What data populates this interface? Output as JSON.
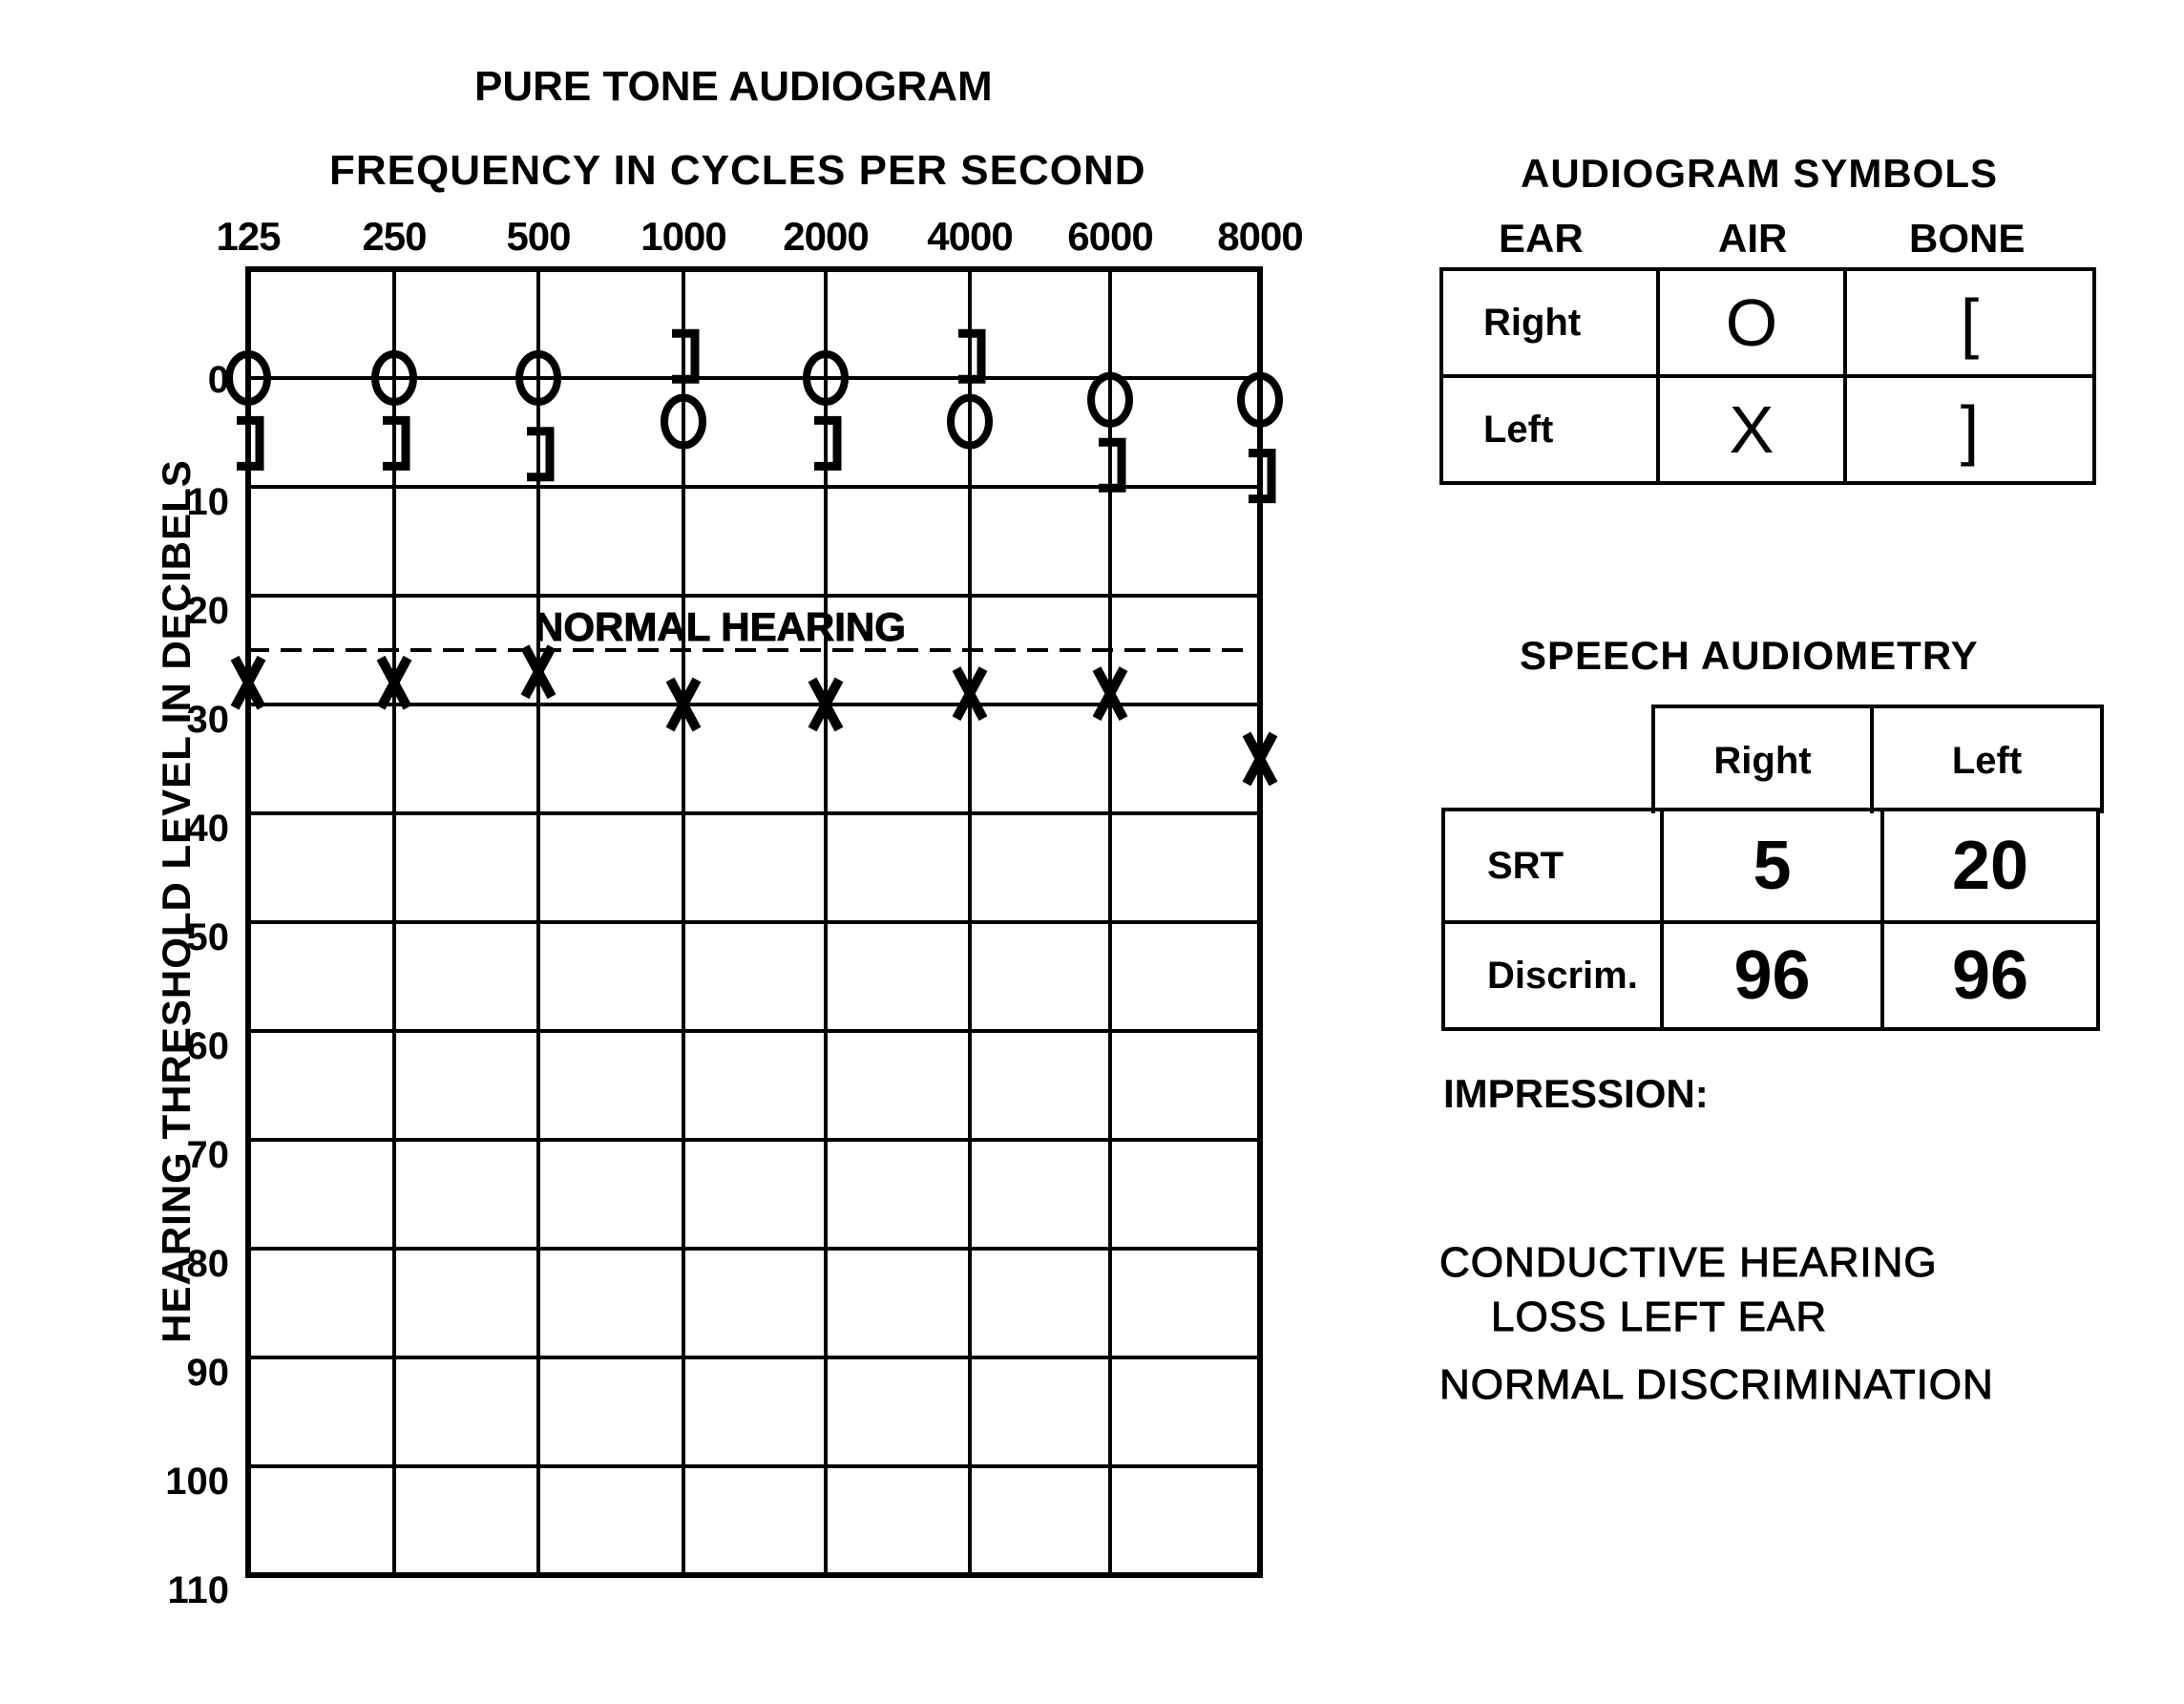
{
  "chart_data": {
    "type": "scatter",
    "title": "PURE TONE AUDIOGRAM",
    "xlabel": "FREQUENCY IN CYCLES PER SECOND",
    "ylabel": "HEARING THRESHOLD LEVEL IN DECIBELS",
    "x_categories": [
      "125",
      "250",
      "500",
      "1000",
      "2000",
      "4000",
      "6000",
      "8000"
    ],
    "y_ticks": [
      "0",
      "10",
      "20",
      "30",
      "40",
      "50",
      "60",
      "70",
      "80",
      "90",
      "100",
      "110"
    ],
    "ylim": [
      -10,
      110
    ],
    "y_inverted": true,
    "grid": true,
    "normal_hearing": {
      "label": "NORMAL HEARING",
      "level_db": 25,
      "style": "dashed"
    },
    "series": [
      {
        "name": "Right Air",
        "symbol": "O",
        "values": [
          0,
          0,
          0,
          4,
          0,
          4,
          2,
          2
        ]
      },
      {
        "name": "Left Air",
        "symbol": "X",
        "values": [
          28,
          28,
          27,
          30,
          30,
          29,
          29,
          35
        ]
      },
      {
        "name": "Left Bone",
        "symbol": "]",
        "values": [
          6,
          6,
          7,
          -2,
          6,
          -2,
          8,
          9
        ]
      }
    ]
  },
  "symbols_table": {
    "title": "AUDIOGRAM SYMBOLS",
    "headers": [
      "EAR",
      "AIR",
      "BONE"
    ],
    "rows": [
      {
        "ear": "Right",
        "air": "O",
        "bone": "["
      },
      {
        "ear": "Left",
        "air": "X",
        "bone": "]"
      }
    ]
  },
  "speech": {
    "title": "SPEECH AUDIOMETRY",
    "headers": [
      "Right",
      "Left"
    ],
    "rows": [
      {
        "label": "SRT",
        "right": "5",
        "left": "20"
      },
      {
        "label": "Discrim.",
        "right": "96",
        "left": "96"
      }
    ]
  },
  "impression": {
    "label": "IMPRESSION:",
    "line1": "CONDUCTIVE HEARING",
    "line2": "LOSS LEFT EAR",
    "line3": "NORMAL DISCRIMINATION"
  }
}
